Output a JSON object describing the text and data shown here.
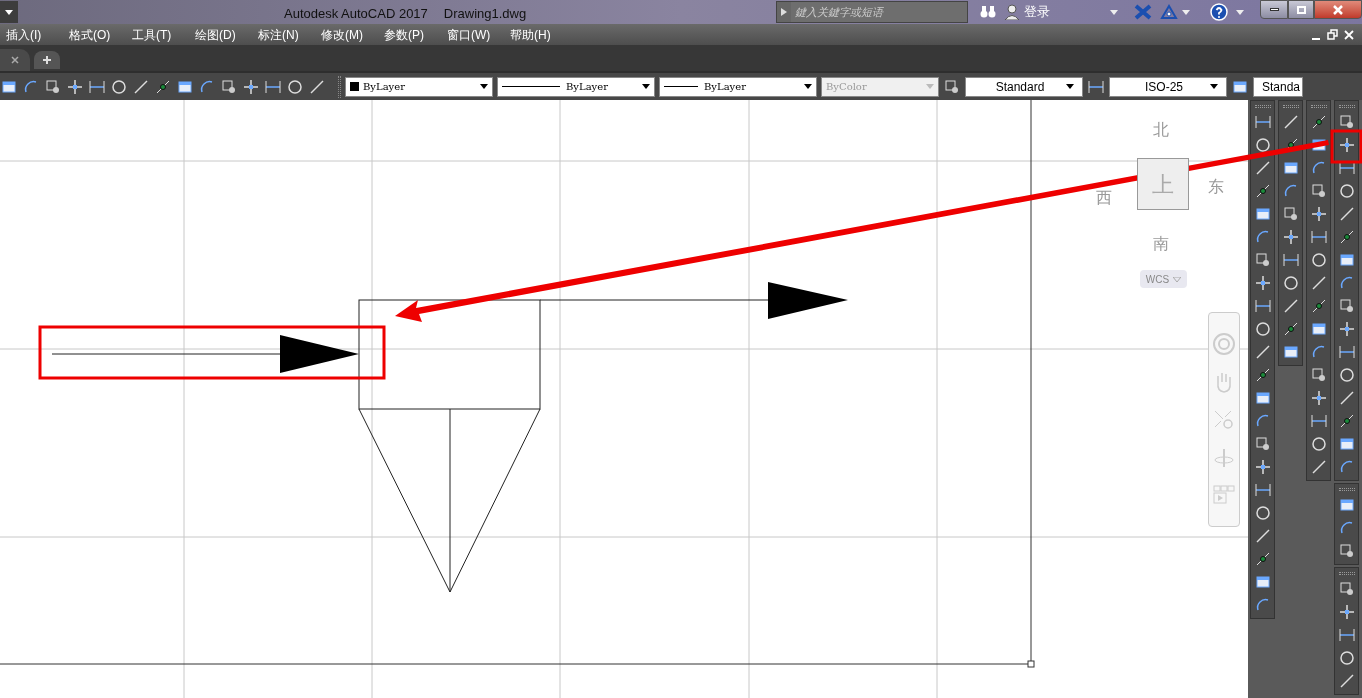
{
  "window": {
    "app_title": "Autodesk AutoCAD 2017",
    "document": "Drawing1.dwg"
  },
  "search": {
    "placeholder": "鍵入关鍵字或短语"
  },
  "account": {
    "login": "登录"
  },
  "menu": [
    "插入(I)",
    "格式(O)",
    "工具(T)",
    "绘图(D)",
    "标注(N)",
    "修改(M)",
    "参数(P)",
    "窗口(W)",
    "帮助(H)"
  ],
  "properties": [
    {
      "kind": "color",
      "value": "ByLayer",
      "disabled": false
    },
    {
      "kind": "linetype",
      "value": "ByLayer",
      "disabled": false
    },
    {
      "kind": "lineweight",
      "value": "ByLayer",
      "disabled": false
    },
    {
      "kind": "plain",
      "value": "ByColor",
      "disabled": true
    }
  ],
  "styles": [
    {
      "value": "Standard"
    },
    {
      "value": "ISO-25"
    },
    {
      "value": "Standa"
    }
  ],
  "viewcube": {
    "north": "北",
    "west": "西",
    "east": "东",
    "south": "南",
    "face": "上",
    "ucs": "WCS"
  }
}
